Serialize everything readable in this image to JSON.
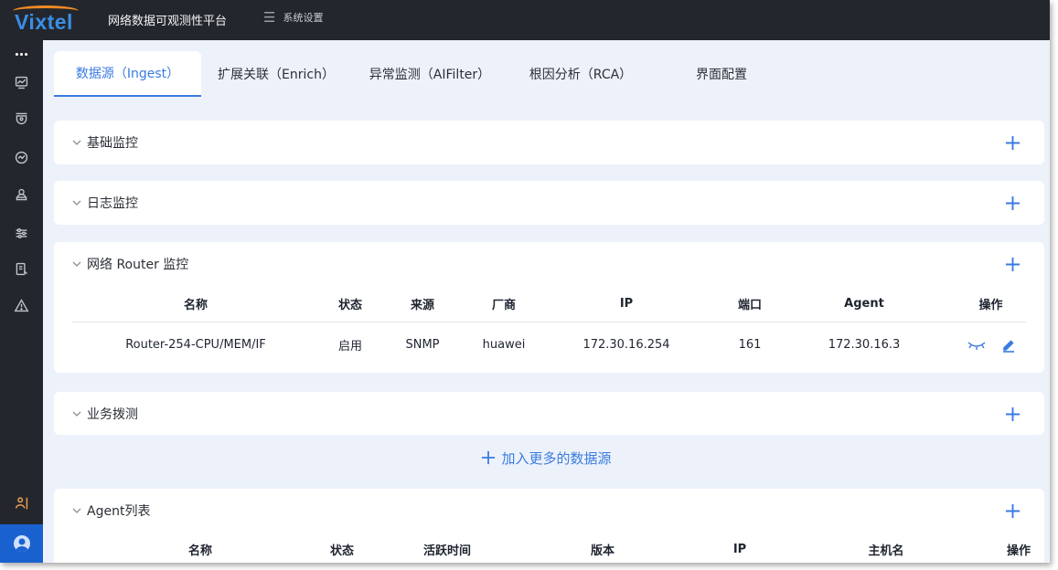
{
  "app": {
    "logo_text": "Vixtel",
    "platform_title": "网络数据可观测性平台",
    "settings_label": "系统设置"
  },
  "sidebar": {
    "items": [
      {
        "name": "more-icon"
      },
      {
        "name": "dashboard-icon"
      },
      {
        "name": "shield-icon"
      },
      {
        "name": "pulse-icon"
      },
      {
        "name": "user-stack-icon"
      },
      {
        "name": "sliders-icon"
      },
      {
        "name": "report-icon"
      },
      {
        "name": "warning-icon"
      },
      {
        "name": "settings-active-icon"
      },
      {
        "name": "avatar-icon"
      }
    ]
  },
  "tabs": [
    {
      "label": "数据源（Ingest）",
      "active": true
    },
    {
      "label": "扩展关联（Enrich）",
      "active": false
    },
    {
      "label": "异常监测（AIFilter）",
      "active": false
    },
    {
      "label": "根因分析（RCA）",
      "active": false
    },
    {
      "label": "界面配置",
      "active": false
    }
  ],
  "sections": {
    "basic": {
      "title": "基础监控"
    },
    "log": {
      "title": "日志监控"
    },
    "router": {
      "title": "网络 Router 监控",
      "columns": [
        "名称",
        "状态",
        "来源",
        "厂商",
        "IP",
        "端口",
        "Agent",
        "操作"
      ],
      "rows": [
        {
          "name": "Router-254-CPU/MEM/IF",
          "status": "启用",
          "source": "SNMP",
          "vendor": "huawei",
          "ip": "172.30.16.254",
          "port": "161",
          "agent": "172.30.16.3"
        }
      ]
    },
    "probe": {
      "title": "业务拨测"
    },
    "add_more": {
      "label": "加入更多的数据源"
    },
    "agent": {
      "title": "Agent列表",
      "columns": [
        "名称",
        "状态",
        "活跃时间",
        "版本",
        "IP",
        "主机名",
        "操作"
      ]
    }
  },
  "colors": {
    "accent": "#3a7be0",
    "topbar": "#23272d",
    "background": "#edf2fa",
    "logo_orange": "#f08a24"
  }
}
